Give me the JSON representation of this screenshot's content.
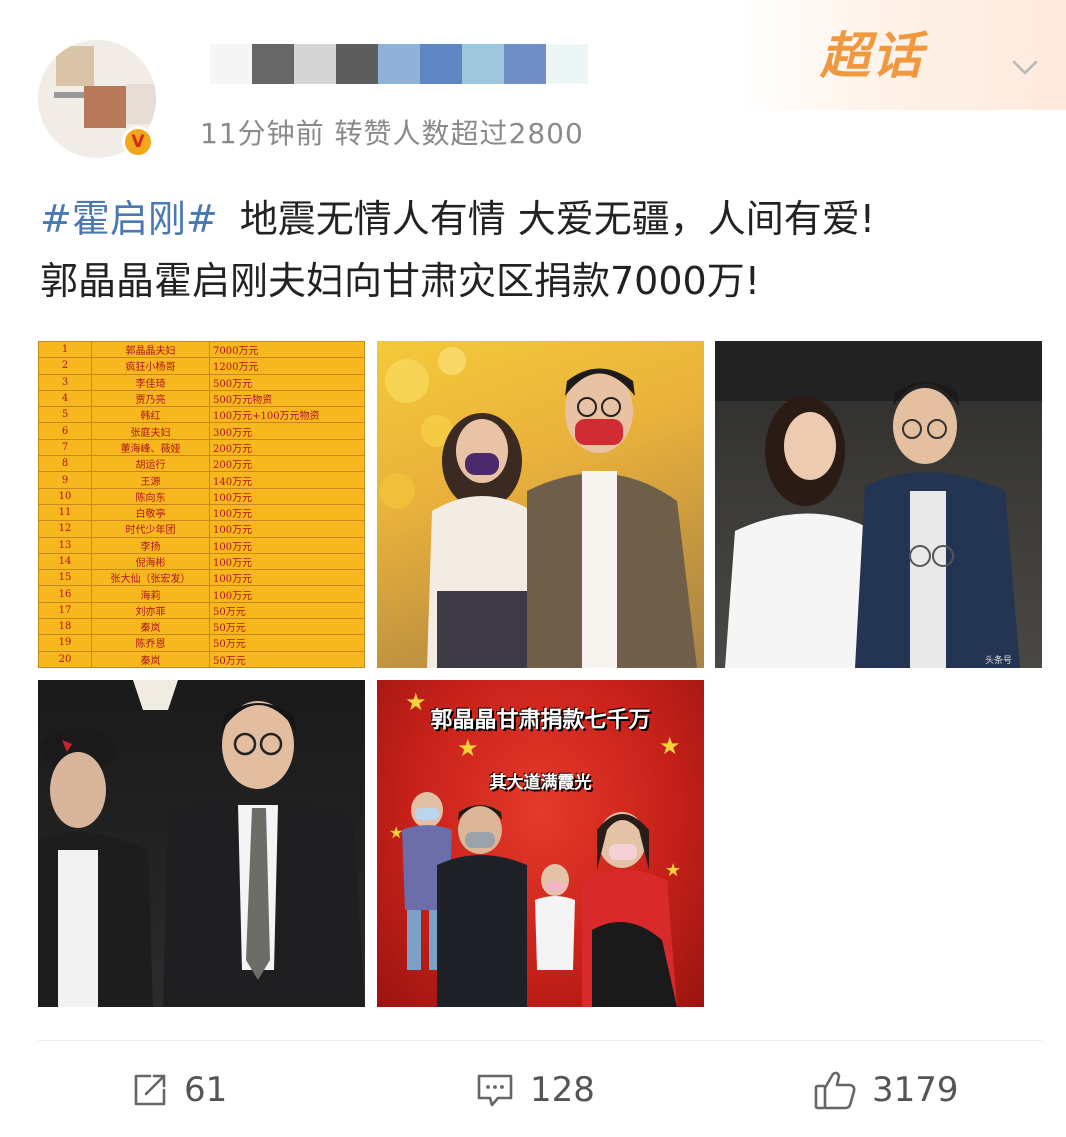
{
  "header": {
    "meta_text": "11分钟前 转赞人数超过2800",
    "super_topic_label": "超话",
    "name_mosaic_colors": [
      "#f5f5f5",
      "#676767",
      "#d5d5d5",
      "#5d5d5d",
      "#90b2d8",
      "#5f86c2",
      "#9ec6dc",
      "#6f8fc6",
      "#edf6f6"
    ]
  },
  "post": {
    "hashtag": "#霍启刚#",
    "line1": "地震无情人有情 大爱无疆，人间有爱!",
    "line2": "郭晶晶霍启刚夫妇向甘肃灾区捐款7000万!"
  },
  "donation_table": [
    {
      "rank": "1",
      "name": "郭晶晶夫妇",
      "amount": "7000万元"
    },
    {
      "rank": "2",
      "name": "疯狂小杨哥",
      "amount": "1200万元"
    },
    {
      "rank": "3",
      "name": "李佳琦",
      "amount": "500万元"
    },
    {
      "rank": "4",
      "name": "贾乃亮",
      "amount": "500万元物资"
    },
    {
      "rank": "5",
      "name": "韩红",
      "amount": "100万元+100万元物资"
    },
    {
      "rank": "6",
      "name": "张庭夫妇",
      "amount": "300万元"
    },
    {
      "rank": "7",
      "name": "董海峰、薇娅",
      "amount": "200万元"
    },
    {
      "rank": "8",
      "name": "胡运行",
      "amount": "200万元"
    },
    {
      "rank": "9",
      "name": "王源",
      "amount": "140万元"
    },
    {
      "rank": "10",
      "name": "陈向东",
      "amount": "100万元"
    },
    {
      "rank": "11",
      "name": "白敬亭",
      "amount": "100万元"
    },
    {
      "rank": "12",
      "name": "时代少年团",
      "amount": "100万元"
    },
    {
      "rank": "13",
      "name": "李扬",
      "amount": "100万元"
    },
    {
      "rank": "14",
      "name": "倪海彬",
      "amount": "100万元"
    },
    {
      "rank": "15",
      "name": "张大仙（张宏发）",
      "amount": "100万元"
    },
    {
      "rank": "16",
      "name": "海莉",
      "amount": "100万元"
    },
    {
      "rank": "17",
      "name": "刘亦菲",
      "amount": "50万元"
    },
    {
      "rank": "18",
      "name": "秦岚",
      "amount": "50万元"
    },
    {
      "rank": "19",
      "name": "陈乔恩",
      "amount": "50万元"
    },
    {
      "rank": "20",
      "name": "秦岚",
      "amount": "50万元"
    }
  ],
  "photo5": {
    "title": "郭晶晶甘肃捐款七千万",
    "subtitle": "其大道满霞光"
  },
  "photo3_watermark": "头条号",
  "actions": {
    "repost_count": "61",
    "comment_count": "128",
    "like_count": "3179"
  },
  "colors": {
    "hashtag": "#4a79b2",
    "super_topic": "#f09840",
    "table_bg": "#f7b81f",
    "table_text": "#b2121b"
  }
}
